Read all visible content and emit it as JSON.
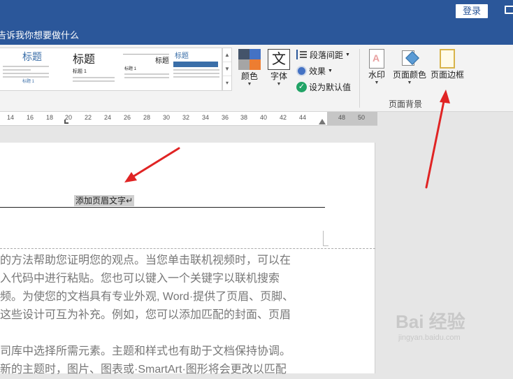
{
  "titlebar": {
    "login_label": "登录"
  },
  "tell_me": {
    "text": "告诉我你想要做什么"
  },
  "ribbon": {
    "style_gallery": [
      {
        "title": "标题",
        "sub": "标题 1"
      },
      {
        "title": "标题",
        "sub": "标题 1"
      },
      {
        "title": "标题",
        "sub": "标题 1"
      },
      {
        "title": "标题",
        "sub": ""
      }
    ],
    "colors_label": "颜色",
    "fonts_label": "字体",
    "fonts_glyph": "文",
    "paragraph_spacing_label": "段落间距",
    "effects_label": "效果",
    "set_default_label": "设为默认值",
    "watermark_label": "水印",
    "page_color_label": "页面颜色",
    "page_borders_label": "页面边框",
    "page_background_group": "页面背景"
  },
  "ruler": {
    "numbers": [
      "14",
      "16",
      "18",
      "20",
      "22",
      "24",
      "26",
      "28",
      "30",
      "32",
      "34",
      "36",
      "38",
      "40",
      "42",
      "44",
      "48",
      "50"
    ]
  },
  "document": {
    "header_text": "添加页眉文字↵",
    "body_lines": [
      "的方法帮助您证明您的观点。当您单击联机视频时，可以在",
      "入代码中进行粘贴。您也可以键入一个关键字以联机搜索",
      "频。为使您的文档具有专业外观, Word·提供了页眉、页脚、",
      "这些设计可互为补充。例如，您可以添加匹配的封面、页眉",
      "",
      "司库中选择所需元素。主题和样式也有助于文档保持协调。",
      "新的主题时，图片、图表或·SmartArt·图形将会更改以匹配"
    ]
  },
  "watermark": {
    "main": "Bai 经验",
    "sub": "jingyan.baidu.com"
  },
  "colors": {
    "ribbon_blue": "#2b579a",
    "arrow_red": "#e02424"
  }
}
